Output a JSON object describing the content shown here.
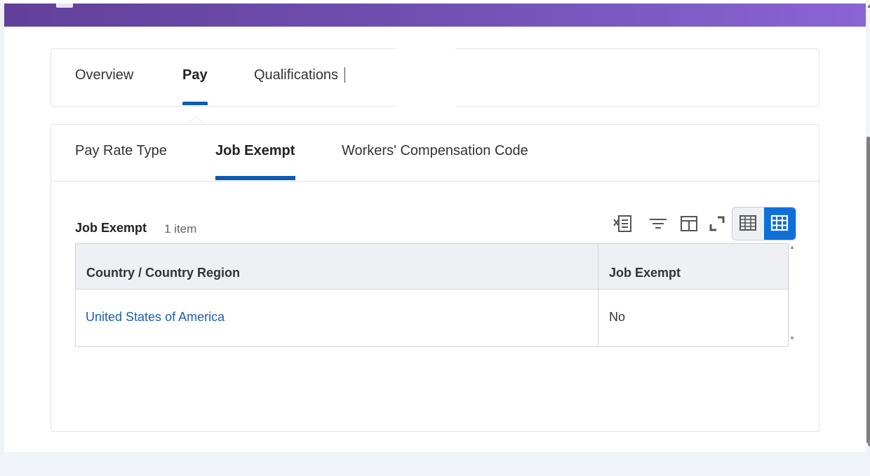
{
  "top_tabs": [
    {
      "label": "Overview",
      "active": false
    },
    {
      "label": "Pay",
      "active": true
    },
    {
      "label": "Qualifications",
      "active": false
    }
  ],
  "sub_tabs": [
    {
      "label": "Pay Rate Type",
      "active": false
    },
    {
      "label": "Job Exempt",
      "active": true
    },
    {
      "label": "Workers' Compensation Code",
      "active": false
    }
  ],
  "grid": {
    "title": "Job Exempt",
    "count": "1 item",
    "columns": [
      "Country / Country Region",
      "Job Exempt"
    ],
    "rows": [
      {
        "country": "United States of America",
        "job_exempt": "No"
      }
    ]
  },
  "toolbar": {
    "icons": [
      "export-to-excel-icon",
      "filter-icon",
      "column-layout-icon",
      "fullscreen-icon",
      "table-view-icon",
      "grid-view-icon"
    ]
  },
  "colors": {
    "header_gradient_start": "#62409a",
    "header_gradient_end": "#8a64d4",
    "accent_blue": "#0e5ab3",
    "link_blue": "#1d5fb5",
    "toggle_active": "#0e6fd8"
  }
}
